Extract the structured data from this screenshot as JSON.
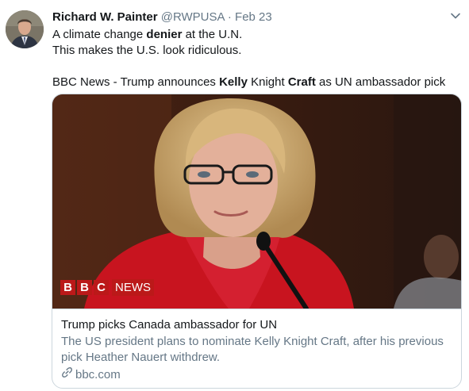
{
  "author": {
    "name": "Richard W. Painter",
    "handle": "@RWPUSA",
    "separator": "·",
    "date": "Feb 23"
  },
  "tweet": {
    "line1_pre": "A climate change ",
    "line1_bold": "denier",
    "line1_post": " at the U.N.",
    "line2": "This makes the U.S. look ridiculous.",
    "line3_pre": "BBC News - Trump announces ",
    "line3_bold1": "Kelly",
    "line3_mid": " Knight ",
    "line3_bold2": "Craft",
    "line3_post": " as UN ambassador pick"
  },
  "card": {
    "logo_letters": [
      "B",
      "B",
      "C"
    ],
    "logo_word": "NEWS",
    "title": "Trump picks Canada ambassador for UN",
    "description": "The US president plans to nominate Kelly Knight Craft, after his previous pick Heather Nauert withdrew.",
    "domain": "bbc.com"
  },
  "icons": {
    "more": "chevron-down-icon",
    "link": "link-icon"
  },
  "colors": {
    "text": "#14171a",
    "secondary": "#657786",
    "border": "#ccd6dd",
    "bbc_red": "#bb1919"
  }
}
